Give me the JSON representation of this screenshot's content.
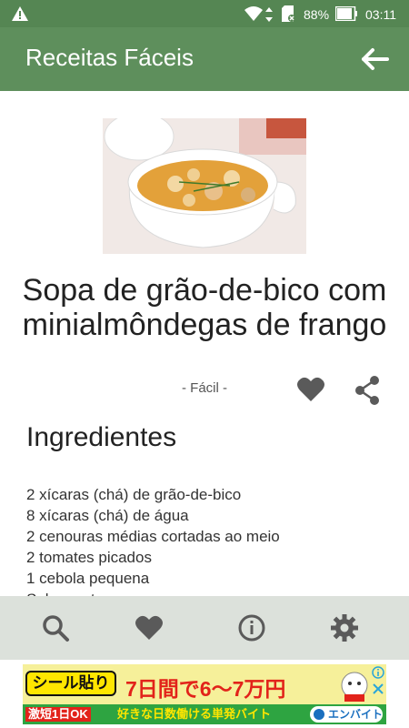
{
  "status_bar": {
    "battery_percent": "88%",
    "time": "03:11",
    "icons": [
      "warning-icon",
      "wifi-icon",
      "data-transfer-icon",
      "sd-card-icon",
      "battery-icon"
    ]
  },
  "app_bar": {
    "title": "Receitas Fáceis",
    "back_icon": "arrow-right-icon"
  },
  "recipe": {
    "image_alt": "soup-bowl-photo",
    "title": "Sopa de grão-de-bico com minialmôndegas de frango",
    "difficulty": "- Fácil -",
    "section_title": "Ingredientes",
    "ingredients": [
      "2 xícaras (chá) de grão-de-bico",
      "8 xícaras (chá) de água",
      "2 cenouras médias cortadas ao meio",
      "2 tomates picados",
      "1 cebola pequena",
      "Sal a gosto"
    ]
  },
  "bottom_nav": {
    "items": [
      "search-icon",
      "heart-icon",
      "info-icon",
      "gear-icon"
    ]
  },
  "ad": {
    "tag": "シール貼り",
    "headline": "7日間で6～7万円",
    "sub_left": "激短1日OK",
    "sub_right": "好きな日数働ける単発バイト",
    "brand": "エンバイト"
  },
  "colors": {
    "status_bar": "#558653",
    "app_bar": "#5e8f5c",
    "bottom_nav": "#dce1db",
    "icon_gray": "#5a5a5a"
  }
}
